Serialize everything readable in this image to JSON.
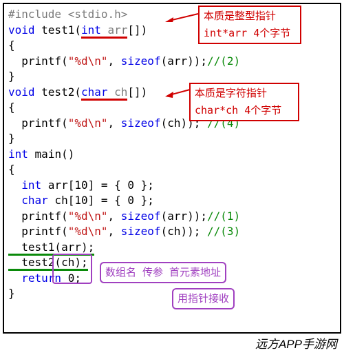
{
  "code": {
    "l1_pp": "#include <stdio.h>",
    "l2_kw": "void",
    "l2_fn": " test1(",
    "l2_ty": "int",
    "l2_pr": " arr",
    "l2_rest": "[])",
    "l3": "{",
    "l4_a": "  printf(",
    "l4_s": "\"%d\\n\"",
    "l4_b": ", ",
    "l4_kw": "sizeof",
    "l4_c": "(arr));",
    "l4_cm": "//(2)",
    "l5": "}",
    "l6_kw": "void",
    "l6_fn": " test2(",
    "l6_ty": "char",
    "l6_pr": " ch",
    "l6_rest": "[])",
    "l7": "{",
    "l8_a": "  printf(",
    "l8_s": "\"%d\\n\"",
    "l8_b": ", ",
    "l8_kw": "sizeof",
    "l8_c": "(ch)); ",
    "l8_cm": "//(4)",
    "l9": "}",
    "l10_ty": "int",
    "l10_fn": " main()",
    "l11": "{",
    "l12_a": "  ",
    "l12_ty": "int",
    "l12_b": " arr[10] = { 0 };",
    "l13_a": "  ",
    "l13_ty": "char",
    "l13_b": " ch[10] = { 0 };",
    "l14_a": "  printf(",
    "l14_s": "\"%d\\n\"",
    "l14_b": ", ",
    "l14_kw": "sizeof",
    "l14_c": "(arr));",
    "l14_cm": "//(1)",
    "l15_a": "  printf(",
    "l15_s": "\"%d\\n\"",
    "l15_b": ", ",
    "l15_kw": "sizeof",
    "l15_c": "(ch)); ",
    "l15_cm": "//(3)",
    "l16": "  test1(arr);",
    "l17": "  test2(ch);",
    "l18_a": "  ",
    "l18_kw": "return",
    "l18_b": " 0;",
    "l19": "}"
  },
  "anno": {
    "box1_l1": "本质是整型指针",
    "box1_l2": "int*arr 4个字节",
    "box2_l1": "本质是字符指针",
    "box2_l2": "char*ch 4个字节",
    "box3": "数组名 传参 首元素地址",
    "box4": "用指针接收"
  },
  "watermark": "远方APP手游网"
}
